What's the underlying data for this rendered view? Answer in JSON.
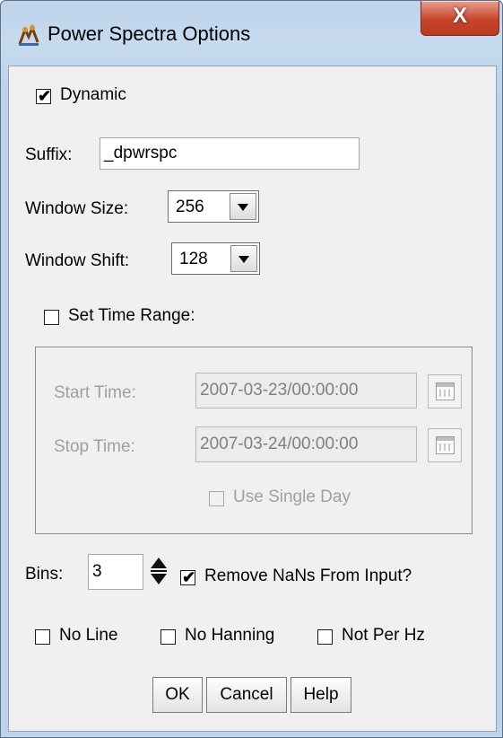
{
  "window": {
    "title": "Power Spectra Options",
    "close_glyph": "X"
  },
  "dynamic": {
    "label": "Dynamic",
    "checked": true
  },
  "suffix": {
    "label": "Suffix:",
    "value": "_dpwrspc"
  },
  "window_size": {
    "label": "Window Size:",
    "value": "256"
  },
  "window_shift": {
    "label": "Window Shift:",
    "value": "128"
  },
  "time_range": {
    "label": "Set Time Range:",
    "checked": false,
    "start_label": "Start Time:",
    "start_value": "2007-03-23/00:00:00",
    "stop_label": "Stop Time:",
    "stop_value": "2007-03-24/00:00:00",
    "single_day_label": "Use Single Day"
  },
  "bins": {
    "label": "Bins:",
    "value": "3"
  },
  "remove_nans": {
    "label": "Remove NaNs From Input?",
    "checked": true
  },
  "options": [
    {
      "label": "No Line",
      "checked": false
    },
    {
      "label": "No Hanning",
      "checked": false
    },
    {
      "label": "Not Per Hz",
      "checked": false
    }
  ],
  "buttons": {
    "ok": "OK",
    "cancel": "Cancel",
    "help": "Help"
  },
  "icons": {
    "app": "app-icon",
    "close": "close-icon",
    "calendar": "calendar-icon",
    "dropdown": "chevron-down-icon",
    "spinner": "spinner-icon",
    "check": "check-mark-icon"
  },
  "colors": {
    "frame": "#bcd3ea",
    "close_button": "#c7452c",
    "client_bg": "#f0f0f0",
    "disabled_text": "#a0a0a0"
  }
}
